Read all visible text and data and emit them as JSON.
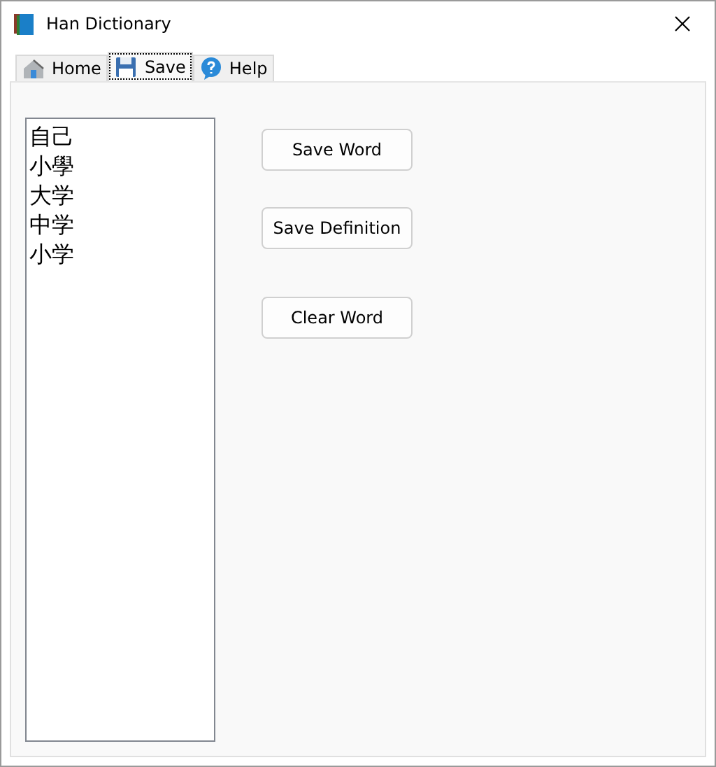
{
  "window": {
    "title": "Han Dictionary"
  },
  "tabs": [
    {
      "label": "Home",
      "kind": "home",
      "selected": false
    },
    {
      "label": "Save",
      "kind": "save",
      "selected": true
    },
    {
      "label": "Help",
      "kind": "help",
      "selected": false
    }
  ],
  "word_list": [
    "自己",
    "小學",
    "大学",
    "中学",
    "小学"
  ],
  "buttons": [
    "Save Word",
    "Save Definition",
    "Clear Word"
  ]
}
